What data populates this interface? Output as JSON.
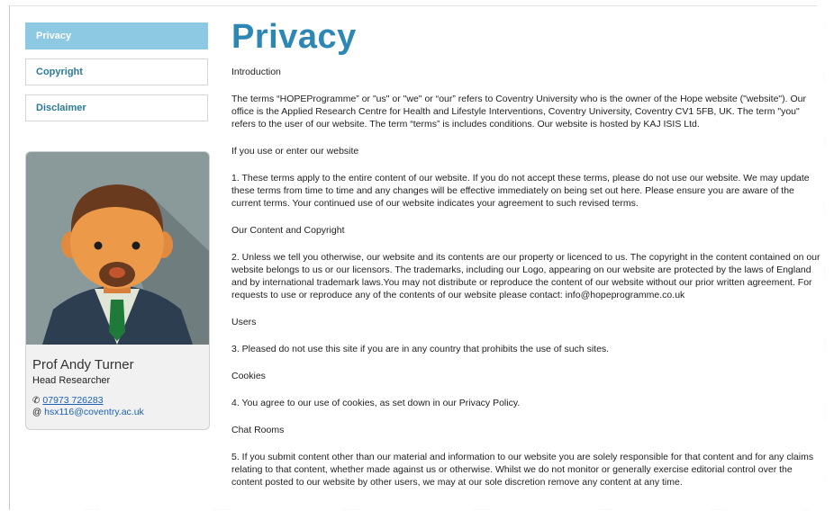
{
  "nav": [
    {
      "label": "Privacy",
      "active": true
    },
    {
      "label": "Copyright",
      "active": false
    },
    {
      "label": "Disclaimer",
      "active": false
    }
  ],
  "profile": {
    "name": "Prof Andy Turner",
    "role": "Head Researcher",
    "phone": "07973 726283",
    "email": "hsx116@coventry.ac.uk",
    "phone_icon": "phone-icon",
    "email_icon": "at-icon"
  },
  "content": {
    "title": "Privacy",
    "paragraphs": [
      "Introduction",
      "The terms “HOPEProgramme” or \"us\" or \"we\" or “our” refers to Coventry University who is the owner of the Hope website (\"website\"). Our office is the Applied Research Centre for Health and Lifestyle Interventions, Coventry University, Coventry CV1 5FB, UK. The term \"you\" refers to the user of our website.  The term “terms” is includes conditions. Our website is hosted by KAJ ISIS Ltd.",
      "If you use or enter our website",
      "1. These terms apply to the entire content of our website. If you do not accept these terms, please do not use our website. We may update these terms from time to time and any changes will be effective immediately on being set out here. Please ensure you are aware of the current terms. Your continued use of our website indicates your agreement to such revised terms.",
      "Our Content and Copyright",
      "2. Unless we tell you otherwise, our website and its contents are our property or licenced to us. The copyright in the content contained on our website belongs to us or our licensors. The trademarks, including our Logo, appearing on our website are protected by the laws of England and by international trademark laws.You may not distribute or reproduce the content of our website without our prior written agreement. For requests to use or reproduce any of the contents of our website please contact: info@hopeprogramme.co.uk",
      "Users",
      "3. Pleased do not use this site if you are in any country that prohibits the use of such sites.",
      "Cookies",
      "4. You agree to our use of cookies, as set down in our Privacy Policy.",
      "Chat Rooms",
      "5. If you submit content other than our material and information to our website you are solely responsible for that content and for any claims relating to that content, whether made against us or otherwise. Whilst we do not monitor or generally exercise editorial control over the content posted to our website by other users, we may at our sole discretion remove any content at any time."
    ]
  },
  "colors": {
    "accent": "#2d87b4",
    "nav_active_bg": "#8ec9e3",
    "link": "#1a5fb4"
  }
}
